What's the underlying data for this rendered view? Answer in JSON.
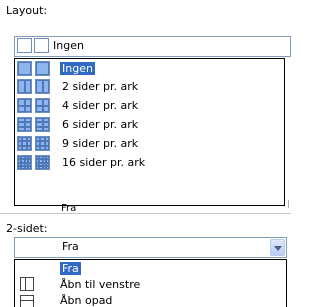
{
  "layout": {
    "label": "Layout:",
    "selected": "Ingen",
    "options": [
      "Ingen",
      "2 sider pr. ark",
      "4 sider pr. ark",
      "6 sider pr. ark",
      "9 sider pr. ark",
      "16 sider pr. ark"
    ],
    "selected_index": 0,
    "behind_text": "Fra"
  },
  "duplex": {
    "label": "2-sidet:",
    "selected": "Fra",
    "options": [
      "Fra",
      "Åbn til venstre",
      "Åbn opad"
    ],
    "selected_index": 0
  },
  "icons": {
    "layout_grid": [
      "grid-1-icon",
      "grid-2-icon",
      "grid-4-icon",
      "grid-6-icon",
      "grid-9-icon",
      "grid-16-icon"
    ],
    "duplex": [
      "book-left-icon",
      "book-up-icon"
    ]
  },
  "colors": {
    "selection": "#316ac5",
    "combo_border": "#7f9db9"
  }
}
